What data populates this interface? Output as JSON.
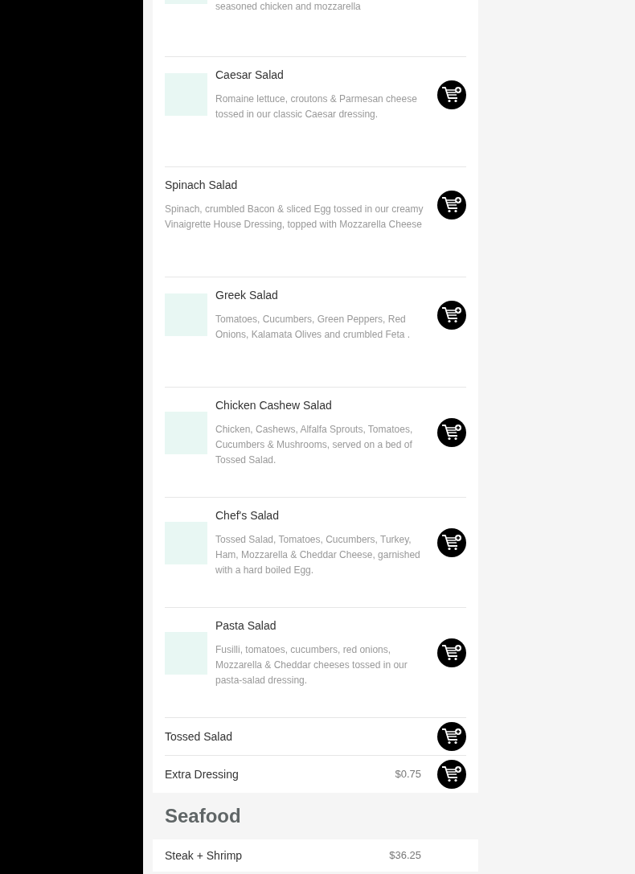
{
  "sections": [
    {
      "items": [
        {
          "kind": "partial",
          "thumbnail": true,
          "description": "seasoned chicken and mozzarella"
        },
        {
          "kind": "detailed",
          "thumbnail": true,
          "name": "Caesar Salad",
          "description": "Romaine lettuce, croutons & Parmesan cheese tossed in our classic Caesar dressing."
        },
        {
          "kind": "detailed",
          "thumbnail": false,
          "name": "Spinach Salad",
          "description": "Spinach, crumbled Bacon & sliced Egg tossed in our creamy Vinaigrette House Dressing, topped with Mozzarella Cheese"
        },
        {
          "kind": "detailed",
          "thumbnail": true,
          "name": "Greek Salad",
          "description": "Tomatoes, Cucumbers, Green Peppers, Red Onions, Kalamata Olives and crumbled Feta ."
        },
        {
          "kind": "detailed",
          "thumbnail": true,
          "name": "Chicken Cashew Salad",
          "description": "Chicken, Cashews, Alfalfa Sprouts, Tomatoes, Cucumbers & Mushrooms, served on a bed of Tossed Salad."
        },
        {
          "kind": "detailed",
          "thumbnail": true,
          "name": "Chef's Salad",
          "description": "Tossed Salad, Tomatoes, Cucumbers, Turkey, Ham, Mozzarella & Cheddar Cheese, garnished with a hard boiled Egg."
        },
        {
          "kind": "detailed",
          "thumbnail": true,
          "name": "Pasta Salad",
          "description": "Fusilli, tomatoes, cucumbers, red onions, Mozzarella & Cheddar cheeses tossed in our pasta-salad dressing."
        },
        {
          "kind": "simple",
          "name": "Tossed Salad"
        },
        {
          "kind": "simple",
          "name": "Extra Dressing",
          "price": "$0.75"
        }
      ]
    },
    {
      "title": "Seafood",
      "items": [
        {
          "kind": "cut",
          "name": "Steak + Shrimp",
          "price": "$36.25"
        }
      ]
    }
  ]
}
